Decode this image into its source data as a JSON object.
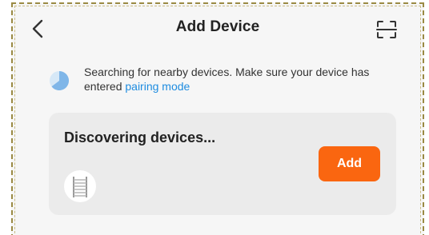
{
  "header": {
    "title": "Add Device",
    "back_icon": "chevron-left-icon",
    "scan_icon": "scan-qr-icon"
  },
  "notice": {
    "icon": "searching-pie-icon",
    "text": "Searching for nearby devices. Make sure your device has entered",
    "link_text": "pairing mode",
    "link_color": "#1e8ce0"
  },
  "discovery": {
    "title": "Discovering devices...",
    "device_icon": "towel-rail-icon",
    "add_label": "Add",
    "accent_color": "#fa6610"
  }
}
